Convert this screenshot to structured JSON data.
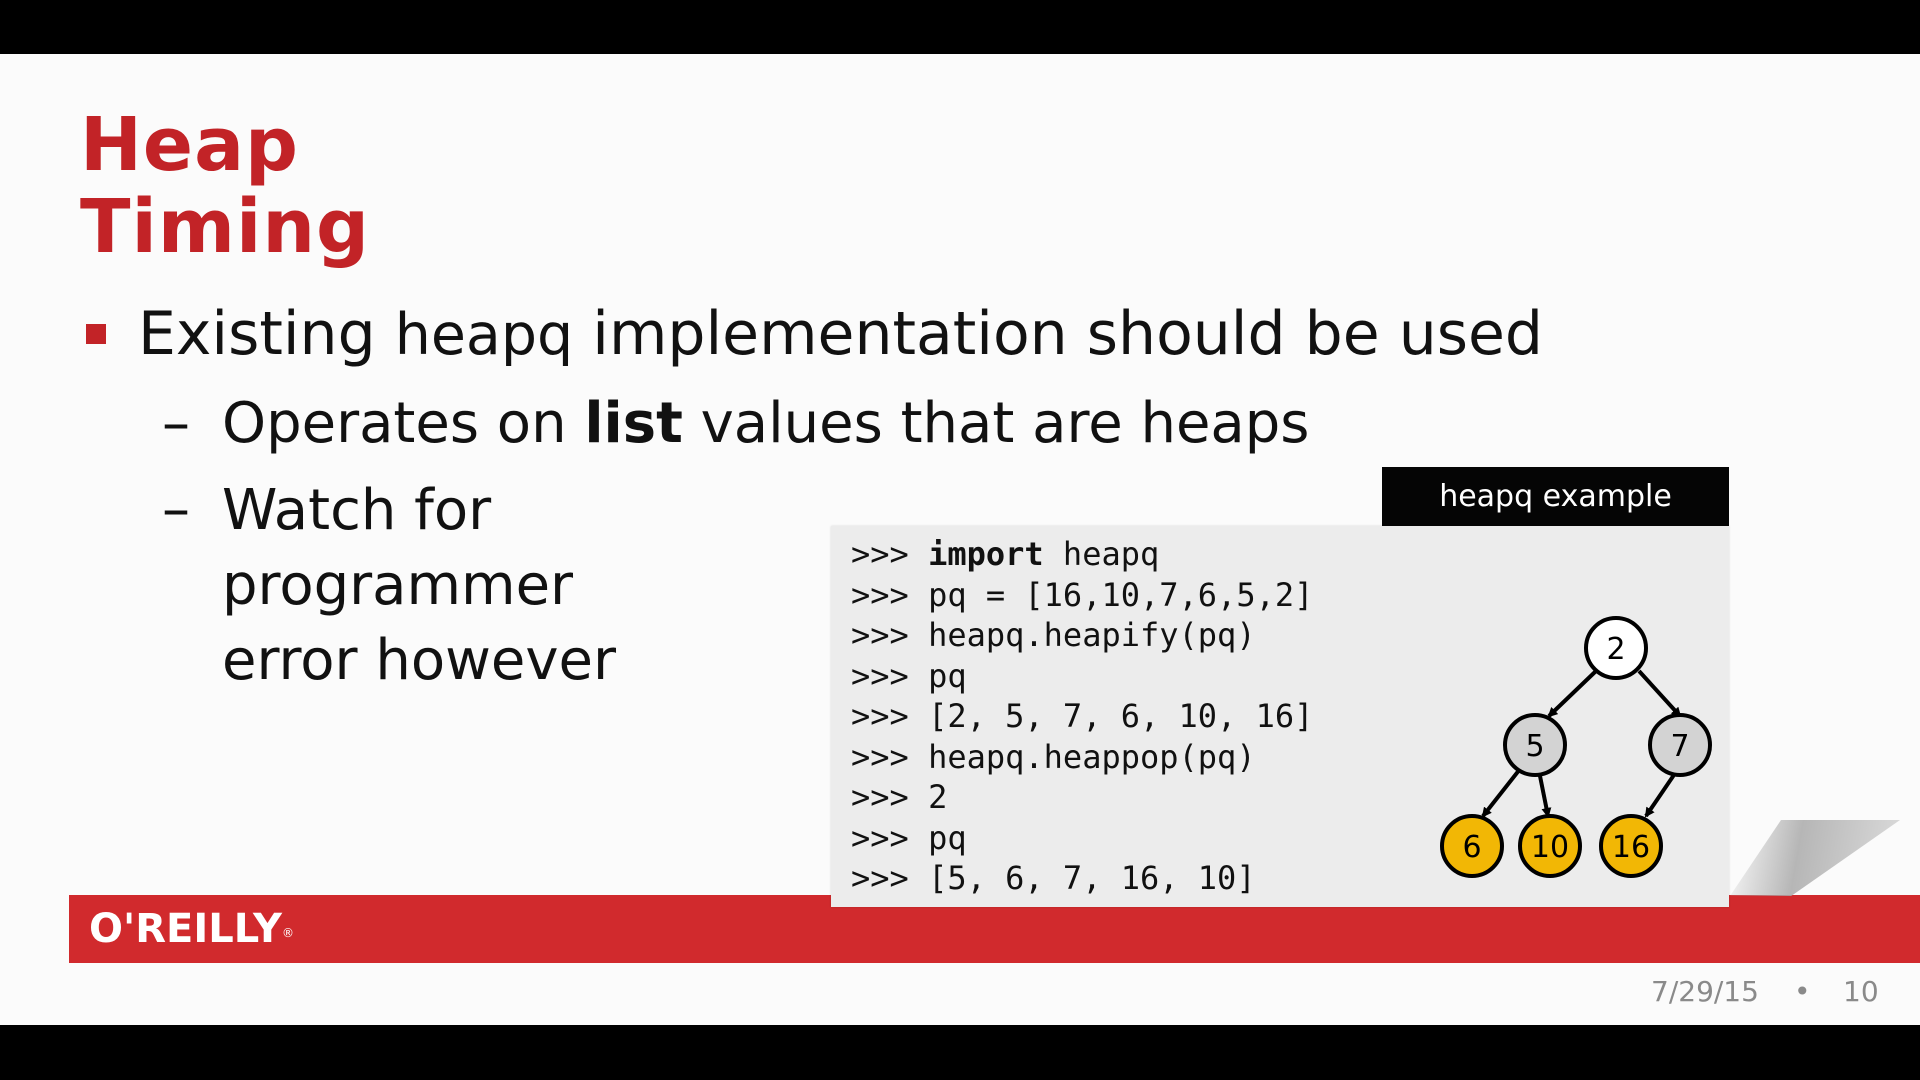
{
  "slide": {
    "title_line1": "Heap",
    "title_line2": "Timing",
    "bullet1_pre": "Existing ",
    "bullet1_code": "heapq",
    "bullet1_post": " implementation should be used",
    "dash": "–",
    "sub1_pre": "Operates on ",
    "sub1_bold": "list",
    "sub1_post": " values that are heaps",
    "sub2_line1": "Watch for",
    "sub2_line2": "programmer",
    "sub2_line3": "error however"
  },
  "example": {
    "tab_label": "heapq example",
    "prompt": ">>> ",
    "lines": [
      {
        "kw": "import",
        "rest": " heapq"
      },
      {
        "kw": "",
        "rest": "pq = [16,10,7,6,5,2]"
      },
      {
        "kw": "",
        "rest": "heapq.heapify(pq)"
      },
      {
        "kw": "",
        "rest": "pq"
      },
      {
        "kw": "",
        "rest": "[2, 5, 7, 6, 10, 16]"
      },
      {
        "kw": "",
        "rest": "heapq.heappop(pq)"
      },
      {
        "kw": "",
        "rest": "2"
      },
      {
        "kw": "",
        "rest": "pq"
      },
      {
        "kw": "",
        "rest": "[5, 6, 7, 16, 10]"
      }
    ],
    "tree": {
      "root": "2",
      "level1": [
        "5",
        "7"
      ],
      "level2": [
        "6",
        "10",
        "16"
      ],
      "colors": {
        "root": "#ffffff",
        "internal": "#d3d3d3",
        "leaf": "#f2b705",
        "stroke": "#000000"
      }
    }
  },
  "brand": {
    "logo": "O'REILLY",
    "reg": "®",
    "color": "#d12a2d"
  },
  "footer": {
    "date": "7/29/15",
    "dot": "•",
    "page": "10"
  },
  "colors": {
    "accent": "#c22327",
    "background": "#fbfbfb"
  }
}
